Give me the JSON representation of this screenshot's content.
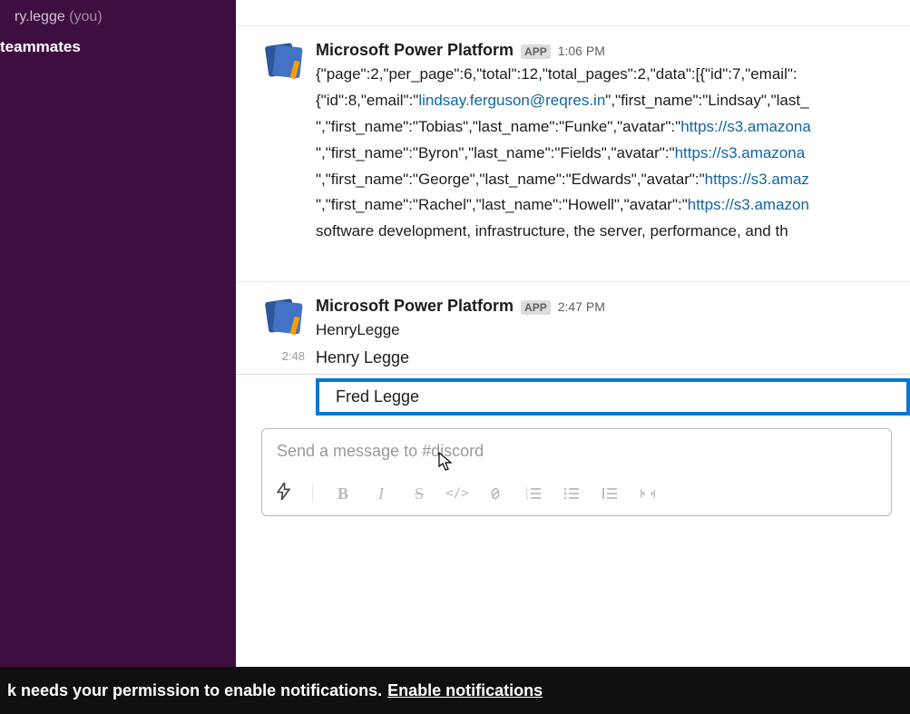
{
  "sidebar": {
    "user": "ry.legge",
    "you_label": "(you)",
    "teammates_label": " teammates"
  },
  "messages": [
    {
      "sender": "Microsoft Power Platform",
      "badge": "APP",
      "time": "1:06 PM",
      "body_pre1": "{\"page\":2,\"per_page\":6,\"total\":12,\"total_pages\":2,\"data\":[{\"id\":7,\"email\":",
      "body_pre2": "{\"id\":8,\"email\":\"",
      "link1": "lindsay.ferguson@reqres.in",
      "body_after_link1": "\",\"first_name\":\"Lindsay\",\"last_",
      "line3_pre": "\",\"first_name\":\"Tobias\",\"last_name\":\"Funke\",\"avatar\":\"",
      "link3": "https://s3.amazona",
      "line4_pre": "\",\"first_name\":\"Byron\",\"last_name\":\"Fields\",\"avatar\":\"",
      "link4": "https://s3.amazona",
      "line5_pre": "\",\"first_name\":\"George\",\"last_name\":\"Edwards\",\"avatar\":\"",
      "link5": "https://s3.amaz",
      "line6_pre": "\",\"first_name\":\"Rachel\",\"last_name\":\"Howell\",\"avatar\":\"",
      "link6": "https://s3.amazon",
      "line7": "software development, infrastructure, the server, performance, and th"
    },
    {
      "sender": "Microsoft Power Platform",
      "badge": "APP",
      "time": "2:47 PM",
      "body": "HenryLegge"
    }
  ],
  "secondary": {
    "time": "2:48",
    "text": "Henry Legge"
  },
  "highlighted": "Fred Legge",
  "composer": {
    "placeholder": "Send a message to #discord"
  },
  "toolbar": {
    "bold": "B",
    "italic": "I",
    "strike": "S",
    "code": "</>",
    "link": "🔗"
  },
  "notification": {
    "text": "k needs your permission to enable notifications.",
    "link": "Enable notifications"
  }
}
